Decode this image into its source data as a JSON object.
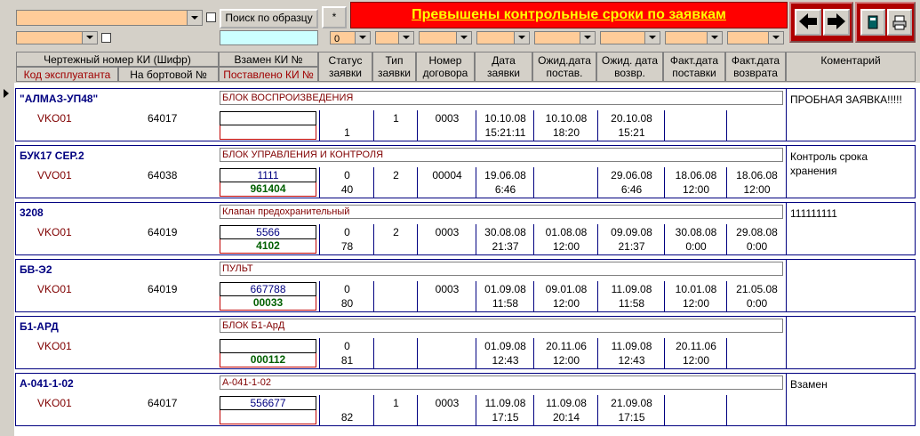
{
  "toolbar": {
    "search_label": "Поиск по образцу",
    "star_label": "*",
    "alert_text": "Превышены контрольные сроки по заявкам",
    "status_filter_value": "0"
  },
  "headers": [
    {
      "id": "h1a",
      "text": "Чертежный номер КИ (Шифр)"
    },
    {
      "id": "h1b",
      "text": "Код эксплуатанта"
    },
    {
      "id": "h1c",
      "text": "На бортовой №"
    },
    {
      "id": "h2a",
      "text": "Взамен КИ №"
    },
    {
      "id": "h2b",
      "text": "Поставлено КИ №"
    },
    {
      "id": "h3",
      "text": "Статус заявки"
    },
    {
      "id": "h4",
      "text": "Тип заявки"
    },
    {
      "id": "h5",
      "text": "Номер договора"
    },
    {
      "id": "h6",
      "text": "Дата заявки"
    },
    {
      "id": "h7",
      "text": "Ожид.дата постав."
    },
    {
      "id": "h8",
      "text": "Ожид. дата возвр."
    },
    {
      "id": "h9",
      "text": "Факт.дата поставки"
    },
    {
      "id": "h10",
      "text": "Факт.дата возврата"
    },
    {
      "id": "h11",
      "text": "Коментарий"
    }
  ],
  "records": [
    {
      "name": "\"АЛМАЗ-УП48\"",
      "desc": "БЛОК ВОСПРОИЗВЕДЕНИЯ",
      "code": "VKO01",
      "board": "64017",
      "ki1": "",
      "ki2": "",
      "status1": "",
      "status2": "1",
      "type": "1",
      "contract": "0003",
      "d1a": "10.10.08",
      "d1b": "15:21:11",
      "d2a": "10.10.08",
      "d2b": "18:20",
      "d3a": "20.10.08",
      "d3b": "15:21",
      "d4a": "",
      "d4b": "",
      "d5a": "",
      "d5b": "",
      "comment": "ПРОБНАЯ ЗАЯВКА!!!!!"
    },
    {
      "name": "БУК17 СЕР.2",
      "desc": "БЛОК УПРАВЛЕНИЯ И КОНТРОЛЯ",
      "code": "VVO01",
      "board": "64038",
      "ki1": "1111",
      "ki2": "961404",
      "status1": "0",
      "status2": "40",
      "type": "2",
      "contract": "00004",
      "d1a": "19.06.08",
      "d1b": "6:46",
      "d2a": "",
      "d2b": "",
      "d3a": "29.06.08",
      "d3b": "6:46",
      "d4a": "18.06.08",
      "d4b": "12:00",
      "d5a": "18.06.08",
      "d5b": "12:00",
      "comment": "Контроль срока хранения"
    },
    {
      "name": "3208",
      "desc": "Клапан предохранительный",
      "code": "VKO01",
      "board": "64019",
      "ki1": "5566",
      "ki2": "4102",
      "status1": "0",
      "status2": "78",
      "type": "2",
      "contract": "0003",
      "d1a": "30.08.08",
      "d1b": "21:37",
      "d2a": "01.08.08",
      "d2b": "12:00",
      "d3a": "09.09.08",
      "d3b": "21:37",
      "d4a": "30.08.08",
      "d4b": "0:00",
      "d5a": "29.08.08",
      "d5b": "0:00",
      "comment": "111111111"
    },
    {
      "name": "БВ-Э2",
      "desc": "ПУЛЬТ",
      "code": "VKO01",
      "board": "64019",
      "ki1": "667788",
      "ki2": "00033",
      "status1": "0",
      "status2": "80",
      "type": "",
      "contract": "0003",
      "d1a": "01.09.08",
      "d1b": "11:58",
      "d2a": "09.01.08",
      "d2b": "12:00",
      "d3a": "11.09.08",
      "d3b": "11:58",
      "d4a": "10.01.08",
      "d4b": "12:00",
      "d5a": "21.05.08",
      "d5b": "0:00",
      "comment": ""
    },
    {
      "name": "Б1-АРД",
      "desc": "БЛОК Б1-АрД",
      "code": "VKO01",
      "board": "",
      "ki1": "",
      "ki2": "000112",
      "status1": "0",
      "status2": "81",
      "type": "",
      "contract": "",
      "d1a": "01.09.08",
      "d1b": "12:43",
      "d2a": "20.11.06",
      "d2b": "12:00",
      "d3a": "11.09.08",
      "d3b": "12:43",
      "d4a": "20.11.06",
      "d4b": "12:00",
      "d5a": "",
      "d5b": "",
      "comment": ""
    },
    {
      "name": "А-041-1-02",
      "desc": "А-041-1-02",
      "code": "VKO01",
      "board": "64017",
      "ki1": "556677",
      "ki2": "",
      "status1": "",
      "status2": "82",
      "type": "1",
      "contract": "0003",
      "d1a": "11.09.08",
      "d1b": "17:15",
      "d2a": "11.09.08",
      "d2b": "20:14",
      "d3a": "21.09.08",
      "d3b": "17:15",
      "d4a": "",
      "d4b": "",
      "d5a": "",
      "d5b": "",
      "comment": "Взамен"
    }
  ]
}
